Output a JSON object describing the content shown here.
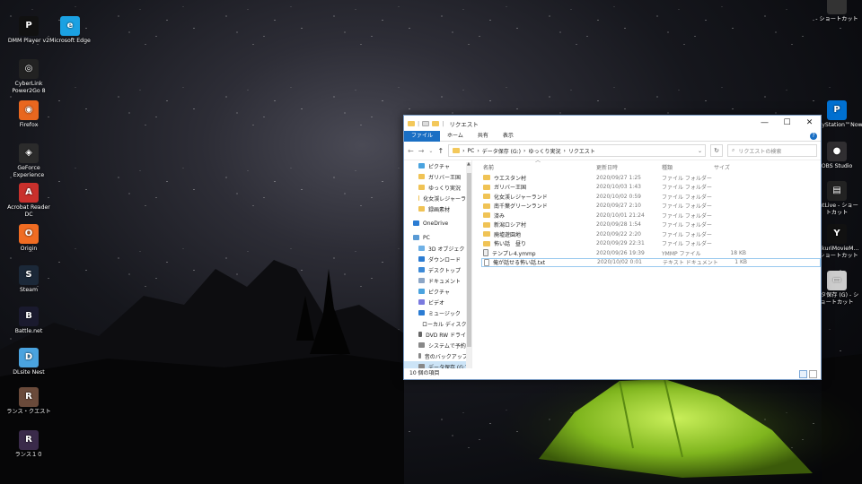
{
  "desktop": {
    "left_icons": [
      {
        "label": "DMM Player v2",
        "icon": "dmm-player-icon",
        "color": "#111111",
        "glyph": "P"
      },
      {
        "label": "Microsoft Edge",
        "icon": "edge-icon",
        "color": "#1ba1e2",
        "glyph": "e"
      },
      {
        "label": "CyberLink Power2Go 8",
        "icon": "power2go-icon",
        "color": "#222222",
        "glyph": "◎"
      },
      {
        "label": "Firefox",
        "icon": "firefox-icon",
        "color": "#e8671f",
        "glyph": "◉"
      },
      {
        "label": "GeForce Experience",
        "icon": "geforce-icon",
        "color": "#2b2b2b",
        "glyph": "◈"
      },
      {
        "label": "Acrobat Reader DC",
        "icon": "acrobat-icon",
        "color": "#c9302c",
        "glyph": "A"
      },
      {
        "label": "Origin",
        "icon": "origin-icon",
        "color": "#f06c22",
        "glyph": "O"
      },
      {
        "label": "Steam",
        "icon": "steam-icon",
        "color": "#1b2838",
        "glyph": "S"
      },
      {
        "label": "Battle.net",
        "icon": "battlenet-icon",
        "color": "#1a1a2e",
        "glyph": "B"
      },
      {
        "label": "DLsite Nest",
        "icon": "dlsite-icon",
        "color": "#4aa3df",
        "glyph": "D"
      },
      {
        "label": "ランス・クエスト",
        "icon": "rance-quest-icon",
        "color": "#6a4a3a",
        "glyph": "R"
      },
      {
        "label": "ランス１０",
        "icon": "rance10-icon",
        "color": "#3a2a4a",
        "glyph": "R"
      }
    ],
    "right_icons": [
      {
        "label": "- ショートカット",
        "icon": "shortcut-icon",
        "color": "#333333",
        "glyph": ""
      },
      {
        "label": "PlayStation™Now",
        "icon": "psnow-icon",
        "color": "#0070d1",
        "glyph": "P"
      },
      {
        "label": "OBS Studio",
        "icon": "obs-icon",
        "color": "#302e31",
        "glyph": "●"
      },
      {
        "label": "putLive - ショートカット",
        "icon": "video-shortcut-icon",
        "color": "#222222",
        "glyph": "▤"
      },
      {
        "label": "ukkuriMovieM... - ショートカット",
        "icon": "ymm-shortcut-icon",
        "color": "#111111",
        "glyph": "Y"
      },
      {
        "label": "ータ保存 (G) - ショートカット",
        "icon": "drive-shortcut-icon",
        "color": "#cccccc",
        "glyph": "▭"
      }
    ]
  },
  "explorer": {
    "title": "リクエスト",
    "controls": {
      "minimize": "—",
      "maximize": "☐",
      "close": "✕"
    },
    "ribbon_tabs": [
      "ファイル",
      "ホーム",
      "共有",
      "表示"
    ],
    "help": "?",
    "breadcrumb": [
      "PC",
      "データ保存 (G:)",
      "ゆっくり実況",
      "リクエスト"
    ],
    "search_placeholder": "リクエストの検索",
    "nav_items": [
      {
        "label": "ピクチャ",
        "icon": "pictures-icon",
        "color": "#4aa3df",
        "indent": 1
      },
      {
        "label": "ガリバー王国",
        "icon": "folder-icon",
        "color": "#f0c355",
        "indent": 1
      },
      {
        "label": "ゆっくり実況",
        "icon": "folder-icon",
        "color": "#f0c355",
        "indent": 1
      },
      {
        "label": "化女渓レジャーラン",
        "icon": "folder-icon",
        "color": "#f0c355",
        "indent": 1
      },
      {
        "label": "録画素材",
        "icon": "folder-icon",
        "color": "#f0c355",
        "indent": 1
      },
      {
        "label": "OneDrive",
        "icon": "onedrive-icon",
        "color": "#2b7cd3",
        "indent": 0
      },
      {
        "label": "PC",
        "icon": "pc-icon",
        "color": "#5a9bd5",
        "indent": 0
      },
      {
        "label": "3D オブジェクト",
        "icon": "3d-objects-icon",
        "color": "#6fb1e6",
        "indent": 1
      },
      {
        "label": "ダウンロード",
        "icon": "downloads-icon",
        "color": "#2b7cd3",
        "indent": 1
      },
      {
        "label": "デスクトップ",
        "icon": "desktop-icon",
        "color": "#3c8ad8",
        "indent": 1
      },
      {
        "label": "ドキュメント",
        "icon": "documents-icon",
        "color": "#8ca6c6",
        "indent": 1
      },
      {
        "label": "ピクチャ",
        "icon": "pictures-icon",
        "color": "#4aa3df",
        "indent": 1
      },
      {
        "label": "ビデオ",
        "icon": "videos-icon",
        "color": "#7a7adf",
        "indent": 1
      },
      {
        "label": "ミュージック",
        "icon": "music-icon",
        "color": "#2b7cd3",
        "indent": 1
      },
      {
        "label": "ローカル ディスク (C",
        "icon": "drive-icon",
        "color": "#888888",
        "indent": 1
      },
      {
        "label": "DVD RW ドライブ",
        "icon": "dvd-icon",
        "color": "#666666",
        "indent": 1
      },
      {
        "label": "システムで予約済",
        "icon": "drive-icon",
        "color": "#888888",
        "indent": 1
      },
      {
        "label": "音のバックアップ (",
        "icon": "drive-icon",
        "color": "#888888",
        "indent": 1
      },
      {
        "label": "データ保存 (G:)",
        "icon": "drive-icon",
        "color": "#888888",
        "indent": 1
      }
    ],
    "columns": {
      "name": "名前",
      "date": "更新日時",
      "type": "種類",
      "size": "サイズ"
    },
    "files": [
      {
        "name": "ウエスタン村",
        "date": "2020/09/27 1:25",
        "type": "ファイル フォルダー",
        "size": "",
        "kind": "folder"
      },
      {
        "name": "ガリバー王国",
        "date": "2020/10/03 1:43",
        "type": "ファイル フォルダー",
        "size": "",
        "kind": "folder"
      },
      {
        "name": "化女渓レジャーランド",
        "date": "2020/10/02 0:59",
        "type": "ファイル フォルダー",
        "size": "",
        "kind": "folder"
      },
      {
        "name": "南千葉グリーンランド",
        "date": "2020/09/27 2:10",
        "type": "ファイル フォルダー",
        "size": "",
        "kind": "folder"
      },
      {
        "name": "済み",
        "date": "2020/10/01 21:24",
        "type": "ファイル フォルダー",
        "size": "",
        "kind": "folder"
      },
      {
        "name": "新潟ロシア村",
        "date": "2020/09/28 1:54",
        "type": "ファイル フォルダー",
        "size": "",
        "kind": "folder"
      },
      {
        "name": "廃墟遊園地",
        "date": "2020/09/22 2:20",
        "type": "ファイル フォルダー",
        "size": "",
        "kind": "folder"
      },
      {
        "name": "怖い話　昼り",
        "date": "2020/09/29 22:31",
        "type": "ファイル フォルダー",
        "size": "",
        "kind": "folder"
      },
      {
        "name": "テンプレ4.ymmp",
        "date": "2020/09/26 19:39",
        "type": "YMMP ファイル",
        "size": "18 KB",
        "kind": "ymm"
      },
      {
        "name": "俺が話せる怖い話.txt",
        "date": "2020/10/02 0:01",
        "type": "テキスト ドキュメント",
        "size": "1 KB",
        "kind": "file"
      }
    ],
    "status": "10 個の項目"
  }
}
